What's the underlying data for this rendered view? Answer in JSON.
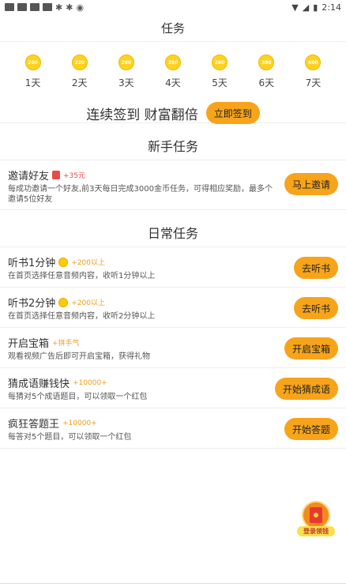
{
  "status_bar": {
    "time": "2:14"
  },
  "header": {
    "title": "任务"
  },
  "checkin": {
    "days": [
      {
        "coin": "200",
        "label": "1天"
      },
      {
        "coin": "220",
        "label": "2天"
      },
      {
        "coin": "260",
        "label": "3天"
      },
      {
        "coin": "350",
        "label": "4天"
      },
      {
        "coin": "260",
        "label": "5天"
      },
      {
        "coin": "380",
        "label": "6天"
      },
      {
        "coin": "600",
        "label": "7天"
      }
    ],
    "slogan": "连续签到 财富翻倍",
    "button": "立即签到"
  },
  "newbie": {
    "title": "新手任务",
    "tasks": [
      {
        "title": "邀请好友",
        "reward": "+35元",
        "desc": "每成功邀请一个好友,前3天每日完成3000金币任务，可得相应奖励，最多个邀请5位好友",
        "button": "马上邀请"
      }
    ]
  },
  "daily": {
    "title": "日常任务",
    "tasks": [
      {
        "title": "听书1分钟",
        "reward": "+200以上",
        "desc": "在首页选择任意音频内容，收听1分钟以上",
        "button": "去听书"
      },
      {
        "title": "听书2分钟",
        "reward": "+200以上",
        "desc": "在首页选择任意音频内容，收听2分钟以上",
        "button": "去听书"
      },
      {
        "title": "开启宝箱",
        "reward": "+拼手气",
        "desc": "观看视频广告后即可开启宝箱，获得礼物",
        "button": "开启宝箱"
      },
      {
        "title": "猜成语赚钱快",
        "reward": "+10000+",
        "desc": "每猜对5个成语题目，可以领取一个红包",
        "button": "开始猜成语"
      },
      {
        "title": "疯狂答题王",
        "reward": "+10000+",
        "desc": "每答对5个题目，可以领取一个红包",
        "button": "开始答题"
      }
    ]
  },
  "float_widget": {
    "label": "登录领钱"
  }
}
